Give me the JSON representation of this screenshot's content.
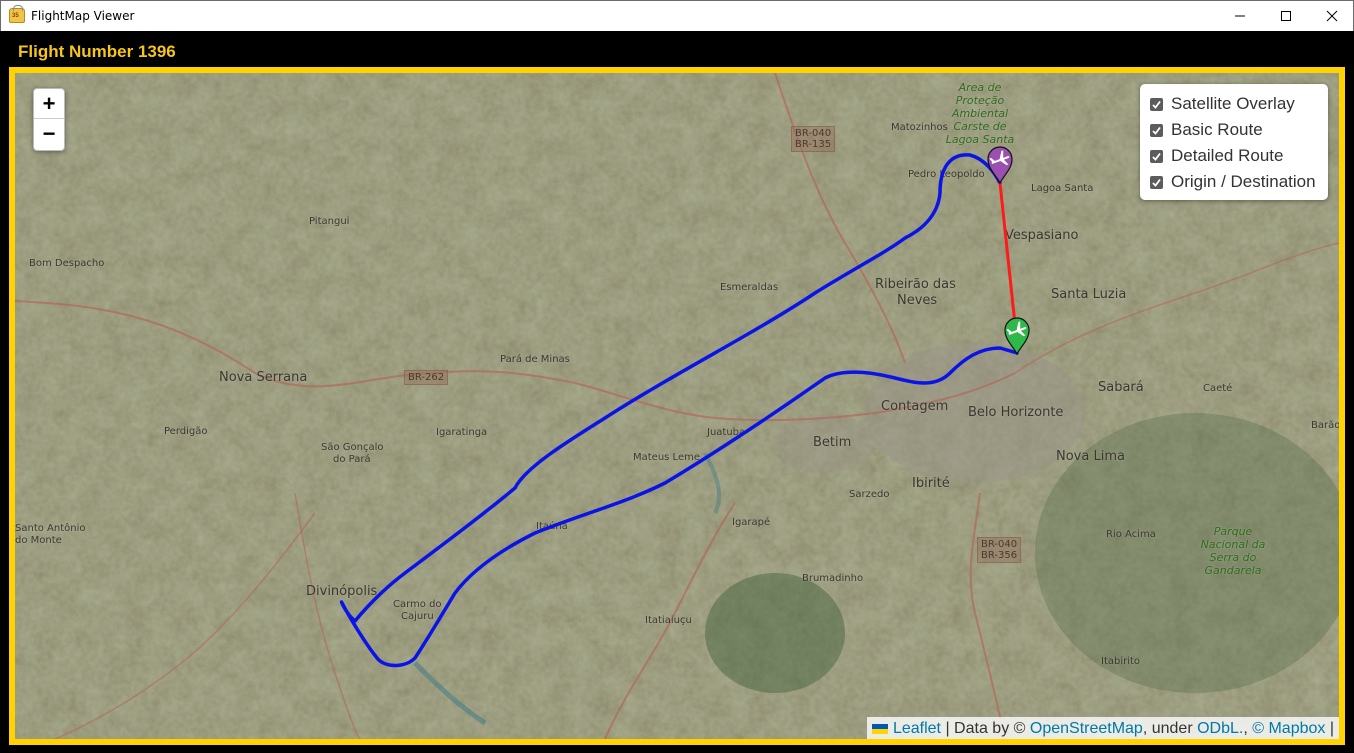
{
  "window": {
    "title": "FlightMap Viewer",
    "app_icon": "suitcase-icon",
    "controls": {
      "minimize": "minimize-icon",
      "maximize": "maximize-icon",
      "close": "close-icon"
    }
  },
  "header": {
    "title": "Flight Number 1396"
  },
  "map": {
    "zoom_in_label": "+",
    "zoom_out_label": "−",
    "layers": [
      {
        "label": "Satellite Overlay",
        "checked": true
      },
      {
        "label": "Basic Route",
        "checked": true
      },
      {
        "label": "Detailed Route",
        "checked": true
      },
      {
        "label": "Origin / Destination",
        "checked": true
      }
    ],
    "attribution": {
      "flag": "ukraine-flag-icon",
      "leaflet": "Leaflet",
      "sep1": " | Data by © ",
      "osm": "OpenStreetMap",
      "sep2": ", under ",
      "odbl": "ODbL.",
      "sep3": ", ",
      "mapbox": "© Mapbox",
      "sep4": " |"
    },
    "markers": {
      "origin": {
        "name": "origin-marker",
        "color": "#9b4fb0",
        "icon": "airplane-icon"
      },
      "destination": {
        "name": "destination-marker",
        "color": "#2fb84a",
        "icon": "airplane-icon"
      }
    },
    "route_colors": {
      "basic": "#ff1a1a",
      "detailed": "#0a14e6"
    },
    "places": [
      {
        "text": "Area de Proteção Ambiental Carste de Lagoa Santa",
        "kind": "park"
      },
      {
        "text": "Matozinhos",
        "kind": "small"
      },
      {
        "text": "Pedro Leopoldo",
        "kind": "small"
      },
      {
        "text": "Lagoa Santa",
        "kind": "small"
      },
      {
        "text": "Vespasiano",
        "kind": "big"
      },
      {
        "text": "Ribeirão das",
        "kind": "big"
      },
      {
        "text": "Neves",
        "kind": "big"
      },
      {
        "text": "Santa Luzia",
        "kind": "big"
      },
      {
        "text": "Esmeraldas",
        "kind": "small"
      },
      {
        "text": "Pitangui",
        "kind": "small"
      },
      {
        "text": "Bom Despacho",
        "kind": "small"
      },
      {
        "text": "Nova Serrana",
        "kind": "big"
      },
      {
        "text": "Pará de Minas",
        "kind": "small"
      },
      {
        "text": "Contagem",
        "kind": "big"
      },
      {
        "text": "Belo Horizonte",
        "kind": "big"
      },
      {
        "text": "Sabará",
        "kind": "big"
      },
      {
        "text": "Caeté",
        "kind": "small"
      },
      {
        "text": "Barão",
        "kind": "small"
      },
      {
        "text": "Perdigão",
        "kind": "small"
      },
      {
        "text": "São Gonçalo",
        "kind": "small"
      },
      {
        "text": "do Pará",
        "kind": "small"
      },
      {
        "text": "Igaratinga",
        "kind": "small"
      },
      {
        "text": "Juatuba",
        "kind": "small"
      },
      {
        "text": "Mateus Leme",
        "kind": "small"
      },
      {
        "text": "Betim",
        "kind": "big"
      },
      {
        "text": "Nova Lima",
        "kind": "big"
      },
      {
        "text": "Ibirité",
        "kind": "big"
      },
      {
        "text": "Sarzedo",
        "kind": "small"
      },
      {
        "text": "Santo Antônio",
        "kind": "small"
      },
      {
        "text": "do Monte",
        "kind": "small"
      },
      {
        "text": "Itaúna",
        "kind": "small"
      },
      {
        "text": "Igarapé",
        "kind": "small"
      },
      {
        "text": "Rio Acima",
        "kind": "small"
      },
      {
        "text": "Parque Nacional da Serra do Gandarela",
        "kind": "park"
      },
      {
        "text": "Divinópolis",
        "kind": "big"
      },
      {
        "text": "Carmo do",
        "kind": "small"
      },
      {
        "text": "Cajuru",
        "kind": "small"
      },
      {
        "text": "Brumadinho",
        "kind": "small"
      },
      {
        "text": "Itatiaiuçu",
        "kind": "small"
      },
      {
        "text": "Itabirito",
        "kind": "small"
      }
    ],
    "shields": [
      {
        "line1": "BR-040",
        "line2": "BR-135"
      },
      {
        "text": "BR-262"
      },
      {
        "line1": "BR-040",
        "line2": "BR-356"
      }
    ]
  }
}
